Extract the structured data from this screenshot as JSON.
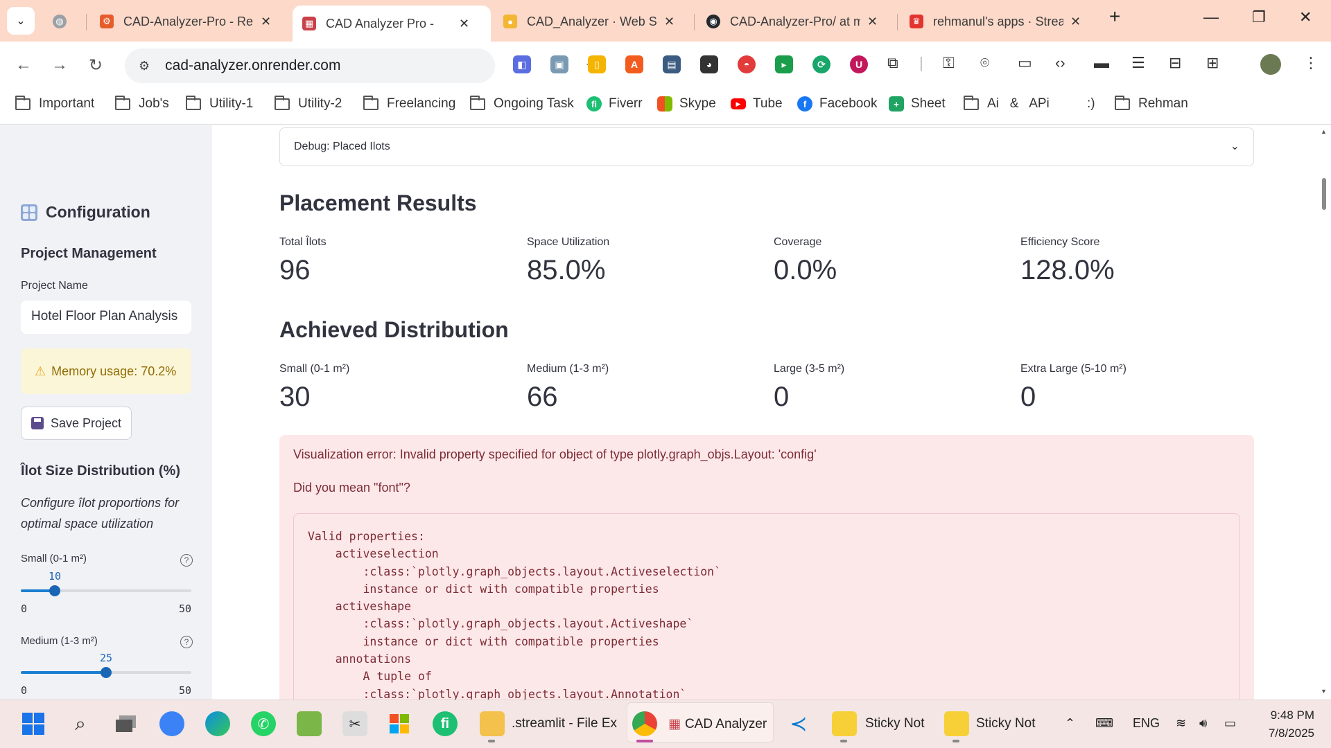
{
  "browser": {
    "tabs": [
      {
        "title": "CAD-Analyzer-Pro - Re",
        "fav_color": "#e65c2b",
        "fav_glyph": "⚙"
      },
      {
        "title": "CAD Analyzer Pro -",
        "fav_color": "#c9414a",
        "fav_glyph": "▦"
      },
      {
        "title": "CAD_Analyzer · Web Se",
        "fav_color": "#f2b632",
        "fav_glyph": "●"
      },
      {
        "title": "CAD-Analyzer-Pro/ at m",
        "fav_color": "#24292e",
        "fav_glyph": "◉"
      },
      {
        "title": "rehmanul's apps · Strea",
        "fav_color": "#e3342f",
        "fav_glyph": "♛"
      }
    ],
    "new_tab": "+",
    "url": "cad-analyzer.onrender.com",
    "bookmarks": [
      {
        "label": "Important",
        "type": "folder"
      },
      {
        "label": "Job's",
        "type": "folder"
      },
      {
        "label": "Utility-1",
        "type": "folder"
      },
      {
        "label": "Utility-2",
        "type": "folder"
      },
      {
        "label": "Freelancing",
        "type": "folder"
      },
      {
        "label": "Ongoing Task",
        "type": "folder"
      },
      {
        "label": "Fiverr",
        "type": "site",
        "color": "#1dbf73",
        "glyph": "fi"
      },
      {
        "label": "Skype",
        "type": "site",
        "color": "#f25022",
        "glyph": "▦"
      },
      {
        "label": "Tube",
        "type": "site",
        "color": "#ff0000",
        "glyph": "▶"
      },
      {
        "label": "Facebook",
        "type": "site",
        "color": "#1877f2",
        "glyph": "f"
      },
      {
        "label": "Sheet",
        "type": "site",
        "color": "#1fa463",
        "glyph": "+"
      },
      {
        "label": "Ai   &   APi",
        "type": "folder"
      },
      {
        "label": ":)",
        "type": "text"
      },
      {
        "label": "Rehman",
        "type": "folder"
      }
    ]
  },
  "sidebar": {
    "title": "Configuration",
    "project_section": "Project Management",
    "project_name_label": "Project Name",
    "project_name_value": "Hotel Floor Plan Analysis",
    "memory_warning": "Memory usage: 70.2%",
    "save_button": "Save Project",
    "distribution_title": "Îlot Size Distribution (%)",
    "distribution_caption": "Configure îlot proportions for optimal space utilization",
    "sliders": [
      {
        "label": "Small (0-1 m²)",
        "value": 10,
        "min": 0,
        "max": 50
      },
      {
        "label": "Medium (1-3 m²)",
        "value": 25,
        "min": 0,
        "max": 50
      }
    ]
  },
  "main": {
    "expander_label": "Debug: Placed Ilots",
    "placement_title": "Placement Results",
    "placement_metrics": [
      {
        "label": "Total Îlots",
        "value": "96"
      },
      {
        "label": "Space Utilization",
        "value": "85.0%"
      },
      {
        "label": "Coverage",
        "value": "0.0%"
      },
      {
        "label": "Efficiency Score",
        "value": "128.0%"
      }
    ],
    "distribution_title": "Achieved Distribution",
    "distribution_metrics": [
      {
        "label": "Small (0-1 m²)",
        "value": "30"
      },
      {
        "label": "Medium (1-3 m²)",
        "value": "66"
      },
      {
        "label": "Large (3-5 m²)",
        "value": "0"
      },
      {
        "label": "Extra Large (5-10 m²)",
        "value": "0"
      }
    ],
    "error_message": "Visualization error: Invalid property specified for object of type plotly.graph_objs.Layout: 'config'",
    "error_suggestion": "Did you mean \"font\"?",
    "error_code": "Valid properties:\n    activeselection\n        :class:`plotly.graph_objects.layout.Activeselection`\n        instance or dict with compatible properties\n    activeshape\n        :class:`plotly.graph_objects.layout.Activeshape`\n        instance or dict with compatible properties\n    annotations\n        A tuple of\n        :class:`plotly.graph_objects.layout.Annotation`"
  },
  "taskbar": {
    "items": [
      {
        "label": ".streamlit - File Ex"
      },
      {
        "label": "CAD Analyzer"
      },
      {
        "label": "Sticky Not"
      },
      {
        "label": "Sticky Not"
      }
    ],
    "language": "ENG",
    "time": "9:48 PM",
    "date": "7/8/2025"
  }
}
